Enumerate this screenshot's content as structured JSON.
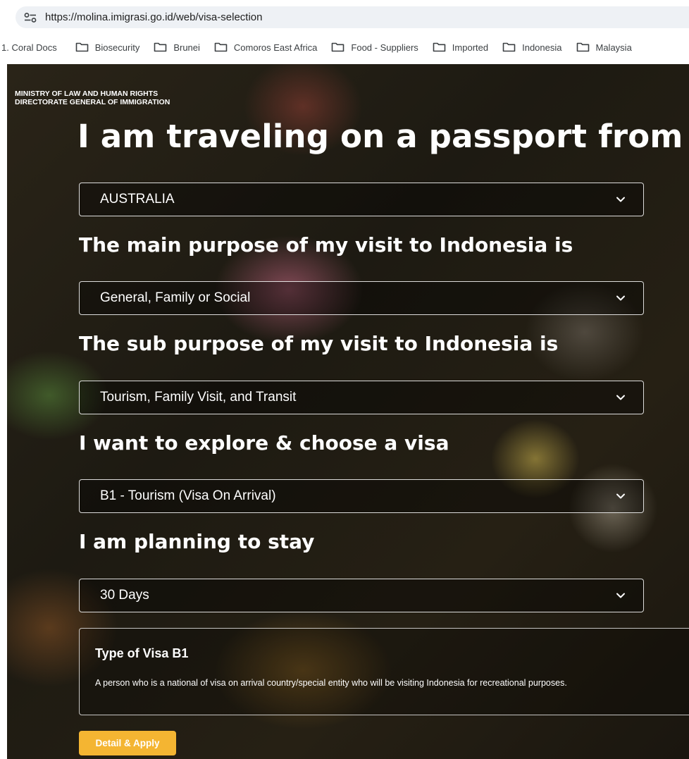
{
  "browser": {
    "url": "https://molina.imigrasi.go.id/web/visa-selection",
    "site_info_icon": "tune-icon",
    "bookmarks": [
      {
        "label": "1. Coral Docs",
        "icon": ""
      },
      {
        "label": "Biosecurity",
        "icon": "folder-icon"
      },
      {
        "label": "Brunei",
        "icon": "folder-icon"
      },
      {
        "label": "Comoros East Africa",
        "icon": "folder-icon"
      },
      {
        "label": "Food - Suppliers",
        "icon": "folder-icon"
      },
      {
        "label": "Imported",
        "icon": "folder-icon"
      },
      {
        "label": "Indonesia",
        "icon": "folder-icon"
      },
      {
        "label": "Malaysia",
        "icon": "folder-icon"
      }
    ]
  },
  "header": {
    "ministry_line1": "MINISTRY OF  LAW  AND HUMAN RIGHTS",
    "ministry_line2": "DIRECTORATE GENERAL OF IMMIGRATION"
  },
  "form": {
    "passport_heading": "I am traveling on a passport from",
    "passport_value": "AUSTRALIA",
    "purpose_heading": "The main purpose of my visit to Indonesia is",
    "purpose_value": "General, Family or Social",
    "sub_purpose_heading": "The sub purpose of my visit to Indonesia is",
    "sub_purpose_value": "Tourism, Family Visit, and Transit",
    "visa_heading": "I want to explore & choose a visa",
    "visa_value": "B1 - Tourism (Visa On Arrival)",
    "stay_heading": "I am planning to stay",
    "stay_value": "30 Days"
  },
  "visa_info": {
    "title": "Type of Visa B1",
    "description": "A person who is a national of visa on arrival country/special entity who will be visiting Indonesia for recreational purposes."
  },
  "actions": {
    "apply_label": "Detail & Apply"
  },
  "colors": {
    "accent": "#f4b532",
    "text": "#ffffff"
  }
}
